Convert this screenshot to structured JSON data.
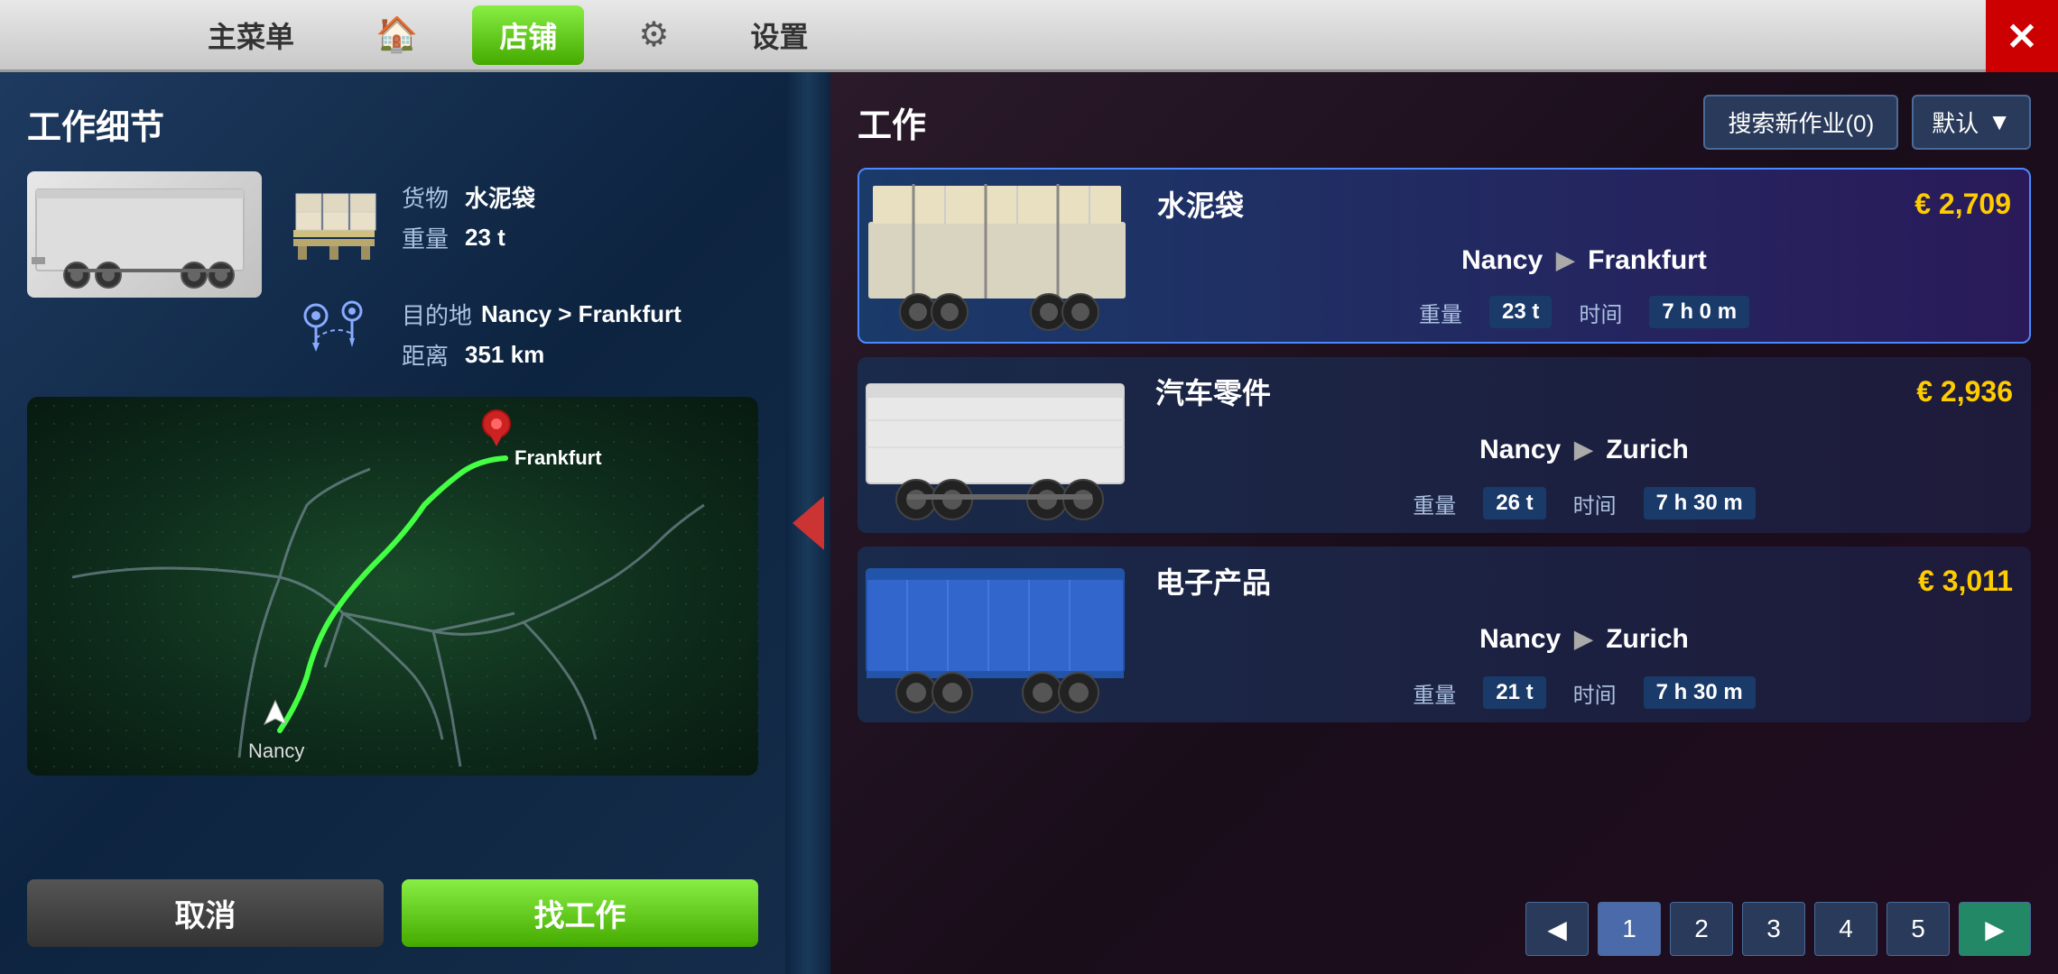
{
  "nav": {
    "items": [
      {
        "id": "main-menu",
        "label": "主菜单",
        "active": false
      },
      {
        "id": "home",
        "label": "🏠",
        "active": false,
        "icon": true
      },
      {
        "id": "shop",
        "label": "店铺",
        "active": true
      },
      {
        "id": "settings-gear",
        "label": "⚙",
        "active": false,
        "icon": true
      },
      {
        "id": "settings",
        "label": "设置",
        "active": false
      }
    ],
    "close_label": "✕"
  },
  "left_panel": {
    "title": "工作细节",
    "cargo_label": "货物",
    "cargo_value": "水泥袋",
    "weight_label": "重量",
    "weight_value": "23 t",
    "destination_label": "目的地",
    "destination_value": "Nancy > Frankfurt",
    "distance_label": "距离",
    "distance_value": "351 km",
    "frankfurt_label": "Frankfurt",
    "nancy_label": "Nancy",
    "btn_cancel": "取消",
    "btn_find_job": "找工作"
  },
  "right_panel": {
    "title": "工作",
    "search_btn": "搜索新作业(0)",
    "default_btn": "默认",
    "jobs": [
      {
        "id": 1,
        "cargo": "水泥袋",
        "price": "€ 2,709",
        "from": "Nancy",
        "to": "Frankfurt",
        "weight": "23 t",
        "time": "7 h 0 m",
        "selected": true,
        "trailer_color": "cargo"
      },
      {
        "id": 2,
        "cargo": "汽车零件",
        "price": "€ 2,936",
        "from": "Nancy",
        "to": "Zurich",
        "weight": "26 t",
        "time": "7 h 30 m",
        "selected": false,
        "trailer_color": "white"
      },
      {
        "id": 3,
        "cargo": "电子产品",
        "price": "€ 3,011",
        "from": "Nancy",
        "to": "Zurich",
        "weight": "21 t",
        "time": "7 h 30 m",
        "selected": false,
        "trailer_color": "blue"
      }
    ],
    "pagination": {
      "pages": [
        "1",
        "2",
        "3",
        "4",
        "5"
      ],
      "current": 1
    },
    "weight_label": "重量",
    "time_label": "时间"
  }
}
